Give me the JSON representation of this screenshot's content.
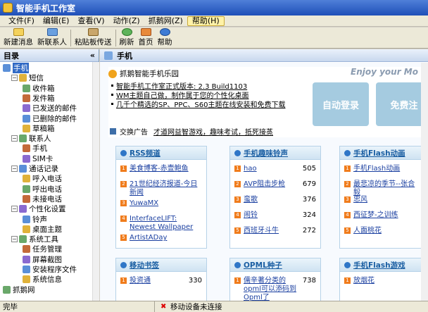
{
  "window": {
    "title": "智能手机工作室"
  },
  "menu": [
    "文件(F)",
    "编辑(E)",
    "查看(V)",
    "动作(Z)",
    "抓鹅网(Z)",
    "帮助(H)"
  ],
  "toolbar": [
    "新建消息",
    "新联系人",
    "粘贴板传送",
    "刷新",
    "首页",
    "帮助"
  ],
  "sidebar": {
    "title": "目录",
    "collapse": "«",
    "tree": [
      {
        "label": "手机",
        "level": 0,
        "selected": true
      },
      {
        "label": "短信",
        "level": 1,
        "exp": "−"
      },
      {
        "label": "收件箱",
        "level": 2
      },
      {
        "label": "发件箱",
        "level": 2
      },
      {
        "label": "已发送的邮件",
        "level": 2
      },
      {
        "label": "已删除的邮件",
        "level": 2
      },
      {
        "label": "草稿箱",
        "level": 2
      },
      {
        "label": "联系人",
        "level": 1,
        "exp": "−"
      },
      {
        "label": "手机",
        "level": 2
      },
      {
        "label": "SIM卡",
        "level": 2
      },
      {
        "label": "通话记录",
        "level": 1,
        "exp": "−"
      },
      {
        "label": "呼入电话",
        "level": 2
      },
      {
        "label": "呼出电话",
        "level": 2
      },
      {
        "label": "未接电话",
        "level": 2
      },
      {
        "label": "个性化设置",
        "level": 1,
        "exp": "−"
      },
      {
        "label": "铃声",
        "level": 2
      },
      {
        "label": "桌面主题",
        "level": 2
      },
      {
        "label": "系统工具",
        "level": 1,
        "exp": "−"
      },
      {
        "label": "任务管理",
        "level": 2
      },
      {
        "label": "屏幕截图",
        "level": 2
      },
      {
        "label": "安装程序文件",
        "level": 2
      },
      {
        "label": "系统信息",
        "level": 2
      },
      {
        "label": "抓鹅网",
        "level": 0
      }
    ]
  },
  "main": {
    "header": "手机",
    "banner_title": "抓鹅智能手机乐园",
    "slogan": "Enjoy your Mo",
    "news": [
      "智能手机工作室正式版本: 2.3 Build1103",
      "WM主题自己做，制作属于您的个性化桌面",
      "几千个精选的SP、PPC、S60主题在线安装和免费下载"
    ],
    "tiles": [
      "自动登录",
      "免费注"
    ],
    "ad_label": "交换广告",
    "ad_link": "才道网益智游戏，趣味考试，抵死接蒸"
  },
  "cards": [
    {
      "title": "RSS频道",
      "items": [
        {
          "n": "1",
          "text": "美食博客-赤壹鲍鱼",
          "count": ""
        },
        {
          "n": "2",
          "text": "21世纪经济报道-今日新闻",
          "count": ""
        },
        {
          "n": "3",
          "text": "YuwaMX",
          "count": ""
        },
        {
          "n": "4",
          "text": "InterfaceLIFT: Newest Wallpaper",
          "count": ""
        },
        {
          "n": "5",
          "text": "ArtistADay",
          "count": ""
        }
      ]
    },
    {
      "title": "手机趣味铃声",
      "items": [
        {
          "n": "1",
          "text": "hao",
          "count": "505"
        },
        {
          "n": "2",
          "text": "AVP阻击步枪",
          "count": "679"
        },
        {
          "n": "3",
          "text": "蛮歌",
          "count": "376"
        },
        {
          "n": "4",
          "text": "闹铃",
          "count": "324"
        },
        {
          "n": "5",
          "text": "西班牙斗牛",
          "count": "272"
        }
      ]
    },
    {
      "title": "手机Flash动画",
      "items": [
        {
          "n": "1",
          "text": "手机Flash动画",
          "count": ""
        },
        {
          "n": "2",
          "text": "最悲凉的季节--张合毅",
          "count": ""
        },
        {
          "n": "3",
          "text": "忠风",
          "count": ""
        },
        {
          "n": "4",
          "text": "西征梦-之训练",
          "count": ""
        },
        {
          "n": "5",
          "text": "人面桃花",
          "count": ""
        }
      ]
    },
    {
      "title": "移动书签",
      "items": [
        {
          "n": "1",
          "text": "投资通",
          "count": "330"
        }
      ]
    },
    {
      "title": "OPML种子",
      "items": [
        {
          "n": "1",
          "text": "儒辛著分类的opml可以添码到Opml了",
          "count": "738"
        }
      ]
    },
    {
      "title": "手机Flash游戏",
      "items": [
        {
          "n": "1",
          "text": "放烟花",
          "count": ""
        }
      ]
    }
  ],
  "status": {
    "left": "完毕",
    "right": "移动设备未连接"
  }
}
